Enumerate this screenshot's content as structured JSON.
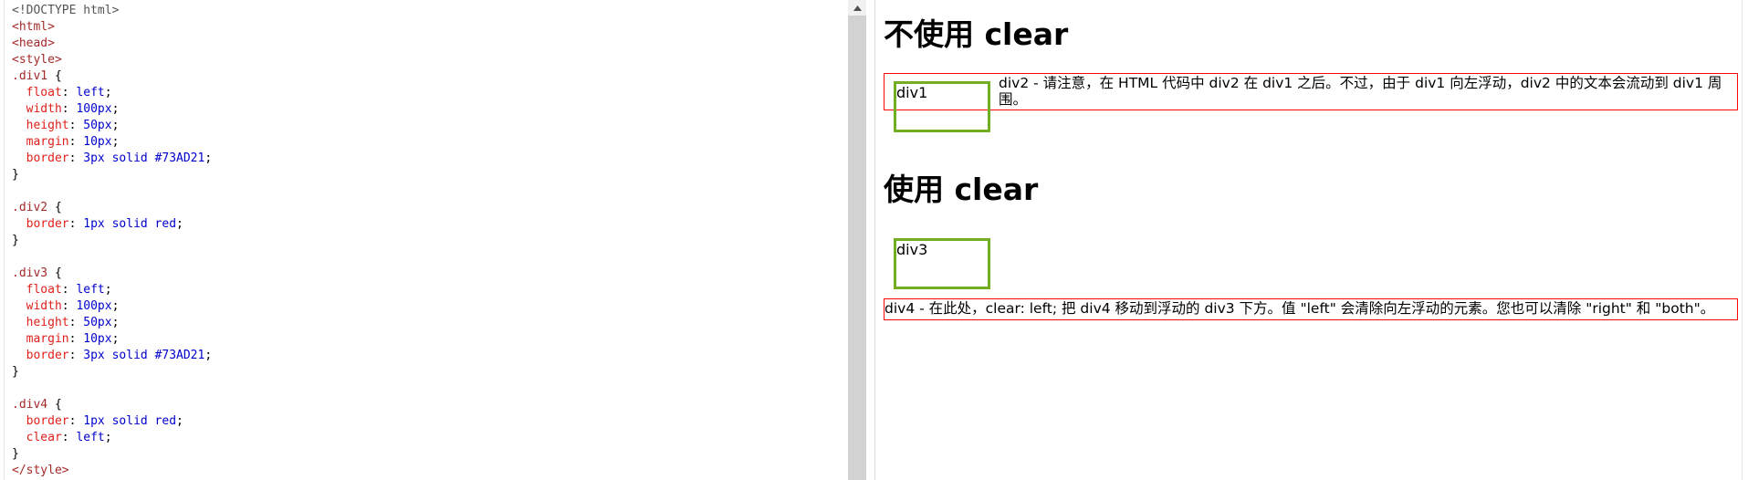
{
  "editor": {
    "lines": [
      [
        {
          "c": "t-doctype",
          "t": "<!DOCTYPE html>"
        }
      ],
      [
        {
          "c": "t-tag",
          "t": "<html>"
        }
      ],
      [
        {
          "c": "t-tag",
          "t": "<head>"
        }
      ],
      [
        {
          "c": "t-tag",
          "t": "<style>"
        }
      ],
      [
        {
          "c": "t-sel",
          "t": ".div1"
        },
        {
          "c": "t-punct",
          "t": " {"
        }
      ],
      [
        {
          "c": "t-punct",
          "t": "  "
        },
        {
          "c": "t-prop",
          "t": "float"
        },
        {
          "c": "t-punct",
          "t": ": "
        },
        {
          "c": "t-val",
          "t": "left"
        },
        {
          "c": "t-punct",
          "t": ";"
        }
      ],
      [
        {
          "c": "t-punct",
          "t": "  "
        },
        {
          "c": "t-prop",
          "t": "width"
        },
        {
          "c": "t-punct",
          "t": ": "
        },
        {
          "c": "t-val",
          "t": "100px"
        },
        {
          "c": "t-punct",
          "t": ";"
        }
      ],
      [
        {
          "c": "t-punct",
          "t": "  "
        },
        {
          "c": "t-prop",
          "t": "height"
        },
        {
          "c": "t-punct",
          "t": ": "
        },
        {
          "c": "t-val",
          "t": "50px"
        },
        {
          "c": "t-punct",
          "t": ";"
        }
      ],
      [
        {
          "c": "t-punct",
          "t": "  "
        },
        {
          "c": "t-prop",
          "t": "margin"
        },
        {
          "c": "t-punct",
          "t": ": "
        },
        {
          "c": "t-val",
          "t": "10px"
        },
        {
          "c": "t-punct",
          "t": ";"
        }
      ],
      [
        {
          "c": "t-punct",
          "t": "  "
        },
        {
          "c": "t-prop",
          "t": "border"
        },
        {
          "c": "t-punct",
          "t": ": "
        },
        {
          "c": "t-val",
          "t": "3px solid #73AD21"
        },
        {
          "c": "t-punct",
          "t": ";"
        }
      ],
      [
        {
          "c": "t-punct",
          "t": "}"
        }
      ],
      [
        {
          "c": "t-punct",
          "t": ""
        }
      ],
      [
        {
          "c": "t-sel",
          "t": ".div2"
        },
        {
          "c": "t-punct",
          "t": " {"
        }
      ],
      [
        {
          "c": "t-punct",
          "t": "  "
        },
        {
          "c": "t-prop",
          "t": "border"
        },
        {
          "c": "t-punct",
          "t": ": "
        },
        {
          "c": "t-val",
          "t": "1px solid red"
        },
        {
          "c": "t-punct",
          "t": ";"
        }
      ],
      [
        {
          "c": "t-punct",
          "t": "}"
        }
      ],
      [
        {
          "c": "t-punct",
          "t": ""
        }
      ],
      [
        {
          "c": "t-sel",
          "t": ".div3"
        },
        {
          "c": "t-punct",
          "t": " {"
        }
      ],
      [
        {
          "c": "t-punct",
          "t": "  "
        },
        {
          "c": "t-prop",
          "t": "float"
        },
        {
          "c": "t-punct",
          "t": ": "
        },
        {
          "c": "t-val",
          "t": "left"
        },
        {
          "c": "t-punct",
          "t": ";"
        }
      ],
      [
        {
          "c": "t-punct",
          "t": "  "
        },
        {
          "c": "t-prop",
          "t": "width"
        },
        {
          "c": "t-punct",
          "t": ": "
        },
        {
          "c": "t-val",
          "t": "100px"
        },
        {
          "c": "t-punct",
          "t": ";"
        }
      ],
      [
        {
          "c": "t-punct",
          "t": "  "
        },
        {
          "c": "t-prop",
          "t": "height"
        },
        {
          "c": "t-punct",
          "t": ": "
        },
        {
          "c": "t-val",
          "t": "50px"
        },
        {
          "c": "t-punct",
          "t": ";"
        }
      ],
      [
        {
          "c": "t-punct",
          "t": "  "
        },
        {
          "c": "t-prop",
          "t": "margin"
        },
        {
          "c": "t-punct",
          "t": ": "
        },
        {
          "c": "t-val",
          "t": "10px"
        },
        {
          "c": "t-punct",
          "t": ";"
        }
      ],
      [
        {
          "c": "t-punct",
          "t": "  "
        },
        {
          "c": "t-prop",
          "t": "border"
        },
        {
          "c": "t-punct",
          "t": ": "
        },
        {
          "c": "t-val",
          "t": "3px solid #73AD21"
        },
        {
          "c": "t-punct",
          "t": ";"
        }
      ],
      [
        {
          "c": "t-punct",
          "t": "}"
        }
      ],
      [
        {
          "c": "t-punct",
          "t": ""
        }
      ],
      [
        {
          "c": "t-sel",
          "t": ".div4"
        },
        {
          "c": "t-punct",
          "t": " {"
        }
      ],
      [
        {
          "c": "t-punct",
          "t": "  "
        },
        {
          "c": "t-prop",
          "t": "border"
        },
        {
          "c": "t-punct",
          "t": ": "
        },
        {
          "c": "t-val",
          "t": "1px solid red"
        },
        {
          "c": "t-punct",
          "t": ";"
        }
      ],
      [
        {
          "c": "t-punct",
          "t": "  "
        },
        {
          "c": "t-prop",
          "t": "clear"
        },
        {
          "c": "t-punct",
          "t": ": "
        },
        {
          "c": "t-val",
          "t": "left"
        },
        {
          "c": "t-punct",
          "t": ";"
        }
      ],
      [
        {
          "c": "t-punct",
          "t": "}"
        }
      ],
      [
        {
          "c": "t-tag",
          "t": "</style>"
        }
      ]
    ]
  },
  "scrollbar": {
    "up_icon": "triangle-up-icon"
  },
  "preview": {
    "heading1": "不使用 clear",
    "div1_label": "div1",
    "div2_text": "div2 - 请注意，在 HTML 代码中 div2 在 div1 之后。不过，由于 div1 向左浮动，div2 中的文本会流动到 div1 周围。",
    "heading2": "使用 clear",
    "div3_label": "div3",
    "div4_text": "div4 - 在此处，clear: left; 把 div4 移动到浮动的 div3 下方。值 \"left\" 会清除向左浮动的元素。您也可以清除 \"right\" 和 \"both\"。"
  },
  "colors": {
    "float_border": "#73AD21",
    "box_border": "#ff0000"
  }
}
